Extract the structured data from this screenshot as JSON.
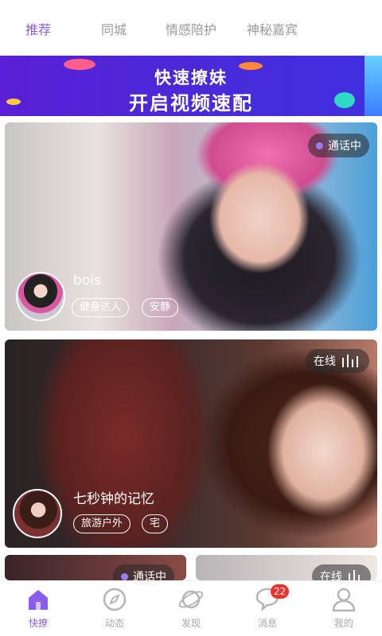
{
  "top_tabs": [
    {
      "label": "推荐",
      "active": true
    },
    {
      "label": "同城",
      "active": false
    },
    {
      "label": "情感陪护",
      "active": false
    },
    {
      "label": "神秘嘉宾",
      "active": false
    }
  ],
  "banner": {
    "line1": "快速撩妹",
    "line2": "开启视频速配"
  },
  "cards": [
    {
      "status": "通话中",
      "name": "bois",
      "tags": [
        "健身达人",
        "安静"
      ]
    },
    {
      "status": "在线",
      "name": "七秒钟的记忆",
      "tags": [
        "旅游户外",
        "宅"
      ]
    },
    {
      "status": "通话中"
    },
    {
      "status": "在线"
    }
  ],
  "bottom_nav": [
    {
      "label": "快撩",
      "icon": "home-icon",
      "active": true
    },
    {
      "label": "动态",
      "icon": "compass-icon",
      "active": false
    },
    {
      "label": "发现",
      "icon": "planet-icon",
      "active": false
    },
    {
      "label": "消息",
      "icon": "chat-bubble-icon",
      "active": false,
      "badge": "22"
    },
    {
      "label": "我的",
      "icon": "user-icon",
      "active": false
    }
  ],
  "colors": {
    "accent": "#8a5cf0",
    "badge_red": "#f0322e",
    "status_dot": "#9a7dff"
  }
}
